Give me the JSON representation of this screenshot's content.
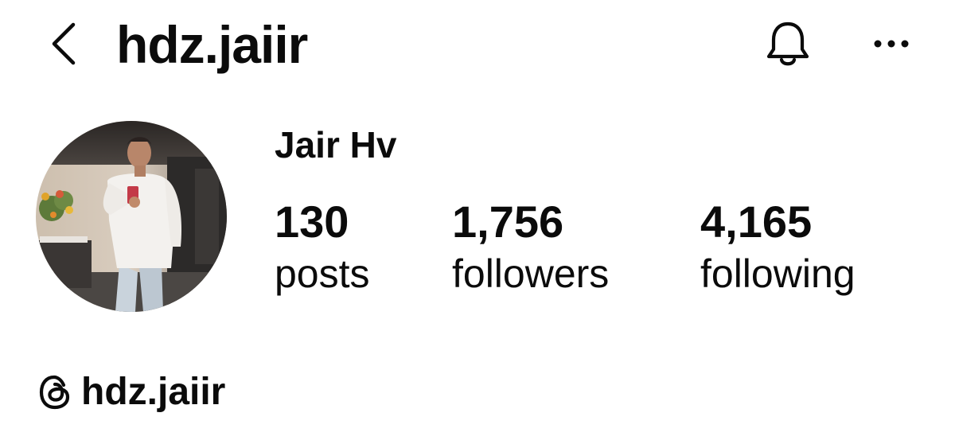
{
  "header": {
    "title": "hdz.jaiir",
    "back_icon": "chevron-left-icon",
    "notifications_icon": "bell-icon",
    "more_icon": "more-horizontal-icon"
  },
  "profile": {
    "display_name": "Jair Hv",
    "avatar": "profile-photo"
  },
  "stats": [
    {
      "value": "130",
      "label": "posts"
    },
    {
      "value": "1,756",
      "label": "followers"
    },
    {
      "value": "4,165",
      "label": "following"
    }
  ],
  "threads": {
    "icon": "threads-icon",
    "handle": "hdz.jaiir"
  },
  "colors": {
    "text": "#0b0b0b",
    "background": "#ffffff"
  }
}
